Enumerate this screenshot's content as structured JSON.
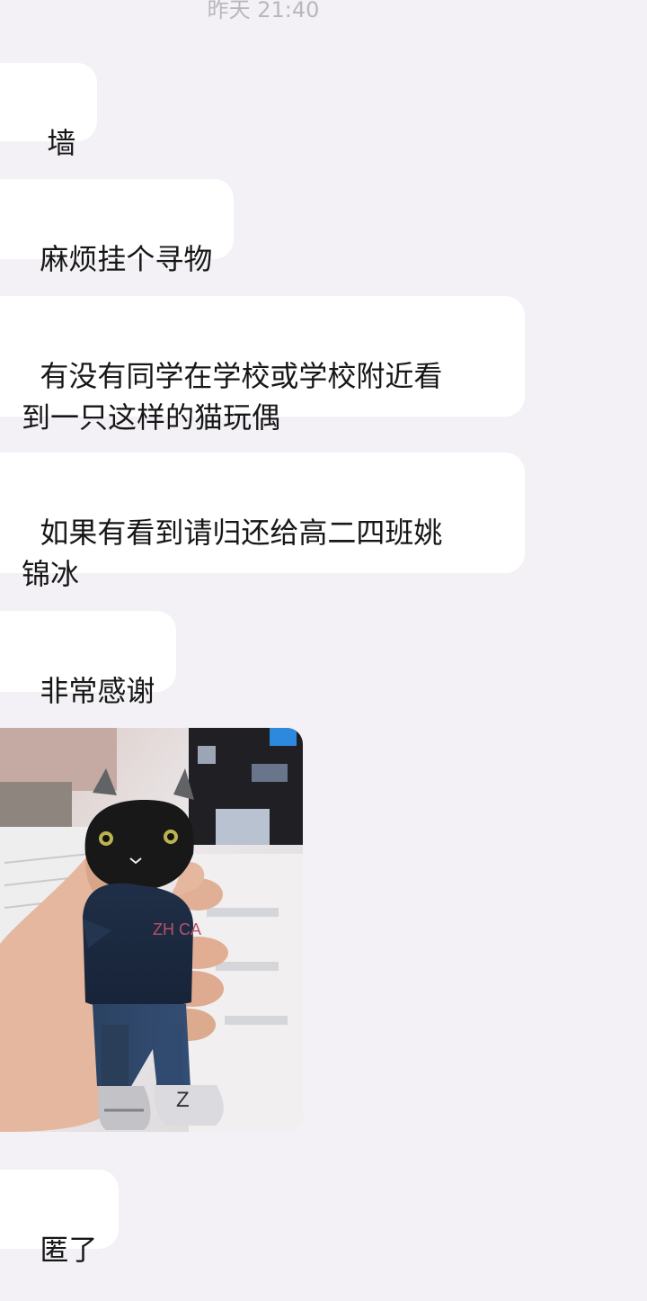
{
  "chat": {
    "timestamp": "昨天 21:40",
    "messages": [
      {
        "text": "墙"
      },
      {
        "text": "麻烦挂个寻物"
      },
      {
        "text": "有没有同学在学校或学校附近看\n到一只这样的猫玩偶"
      },
      {
        "text": "如果有看到请归还给高二四班姚\n锦冰"
      },
      {
        "text": "非常感谢"
      },
      {
        "text": "匿了"
      }
    ],
    "image": {
      "description": "black cat plush doll in dark blue sweater held in hand",
      "doll_letters": "ZH CA",
      "shoe_letter": "Z"
    }
  }
}
